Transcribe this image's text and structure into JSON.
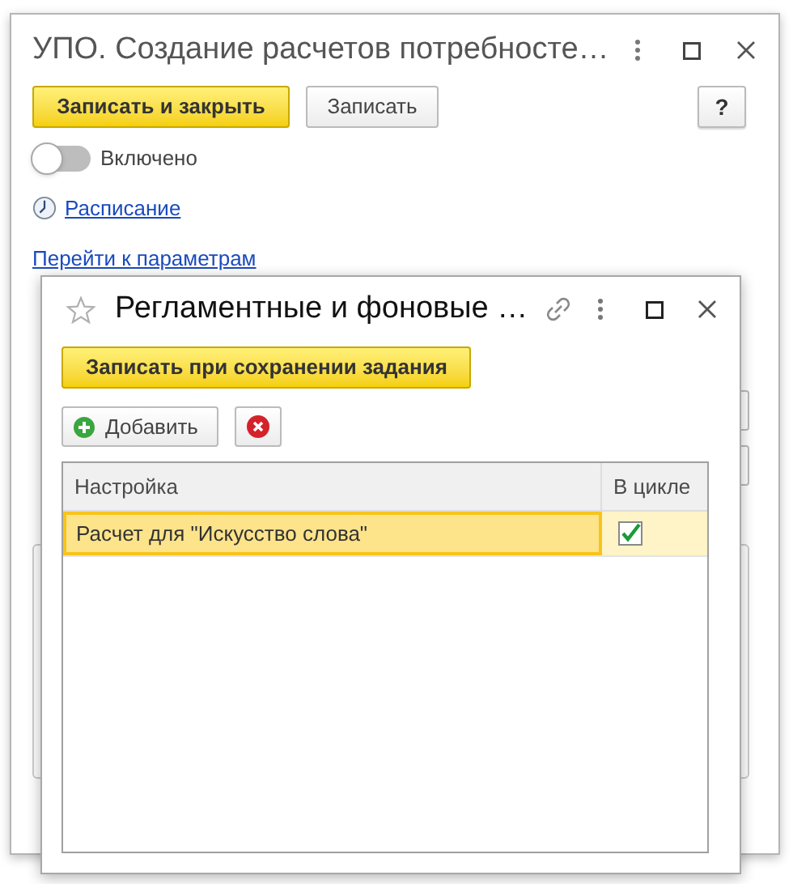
{
  "main_window": {
    "title": "УПО. Создание расчетов потребносте…",
    "buttons": [
      {
        "label": "Записать и закрыть",
        "kind": "primary"
      },
      {
        "label": "Записать",
        "kind": "default"
      }
    ],
    "help_button": "?",
    "toggle": {
      "label": "Включено",
      "on": false
    },
    "schedule_link": "Расписание",
    "params_link": "Перейти к параметрам"
  },
  "dialog": {
    "title": "Регламентные и фоновые …",
    "save_button": "Записать при сохранении задания",
    "add_button": "Добавить",
    "table": {
      "columns": [
        "Настройка",
        "В цикле"
      ],
      "rows": [
        {
          "setting": "Расчет для \"Искусство слова\"",
          "in_cycle": true,
          "selected": true
        }
      ]
    }
  }
}
